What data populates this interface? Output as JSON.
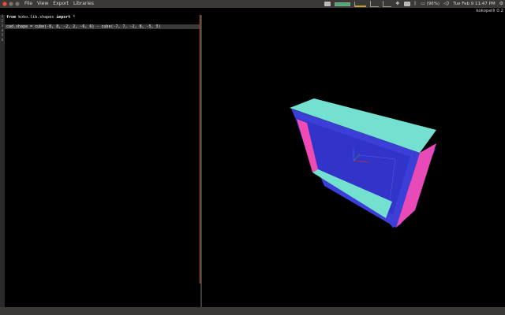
{
  "menubar": {
    "items": [
      "File",
      "View",
      "Export",
      "Libraries"
    ]
  },
  "tray": {
    "battery": "(96%)",
    "clock": "Tue Feb 9 11:47 PM"
  },
  "window": {
    "title": "kokopelli 0.2"
  },
  "editor": {
    "line_numbers": [
      "1",
      "2",
      "3",
      "4",
      "5",
      "6"
    ],
    "lines": {
      "l1_kw1": "from",
      "l1_mod": "koko.lib.shapes",
      "l1_kw2": "import",
      "l1_rest": "*",
      "l3": "cad.shape = cube(-8, 8, -2, 2, -6, 6) - cube(-7, 7, -2, 8, -5, 5)"
    }
  },
  "viewport": {
    "shape": "hollow-box-render",
    "colors": {
      "face_front": "#3b3fd8",
      "face_top": "#74e0d0",
      "face_inner_left": "#f04bb5",
      "face_inner_bottom": "#74e0d0",
      "face_right": "#e84ab8",
      "axis_red": "#c03030",
      "axis_green": "#30a040",
      "axis_blue": "#4060e0"
    }
  },
  "colors": {
    "panel_bar": "#3a3935",
    "margin_line": "#c9553f",
    "current_line": "#3a3a3a"
  }
}
